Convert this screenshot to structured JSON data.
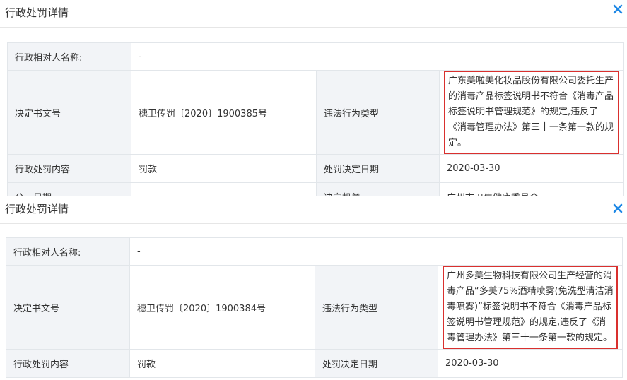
{
  "labels": {
    "party_name": "行政相对人名称:",
    "decision_no": "决定书文号",
    "violation_type": "违法行为类型",
    "penalty_content": "行政处罚内容",
    "decision_date": "处罚决定日期",
    "publish_date": "公示日期:",
    "authority": "决定机关:"
  },
  "records": [
    {
      "title": "行政处罚详情",
      "party_name": "-",
      "decision_no": "穗卫传罚〔2020〕1900385号",
      "violation_type": "广东美啦美化妆品股份有限公司委托生产的消毒产品标签说明书不符合《消毒产品标签说明书管理规范》的规定,违反了《消毒管理办法》第三十一条第一款的规定。",
      "penalty_content": "罚款",
      "decision_date": "2020-03-30",
      "publish_date": "-",
      "authority": "广州市卫生健康委员会"
    },
    {
      "title": "行政处罚详情",
      "party_name": "-",
      "decision_no": "穗卫传罚〔2020〕1900384号",
      "violation_type": "广州多美生物科技有限公司生产经营的消毒产品“多美75%酒精喷雾(免洗型清洁消毒喷雾)”标签说明书不符合《消毒产品标签说明书管理规范》的规定,违反了《消毒管理办法》第三十一条第一款的规定。",
      "penalty_content": "罚款",
      "decision_date": "2020-03-30"
    }
  ],
  "icons": {
    "close": "close-icon"
  },
  "colors": {
    "accent": "#1e88e5",
    "highlight": "#d9302e"
  }
}
